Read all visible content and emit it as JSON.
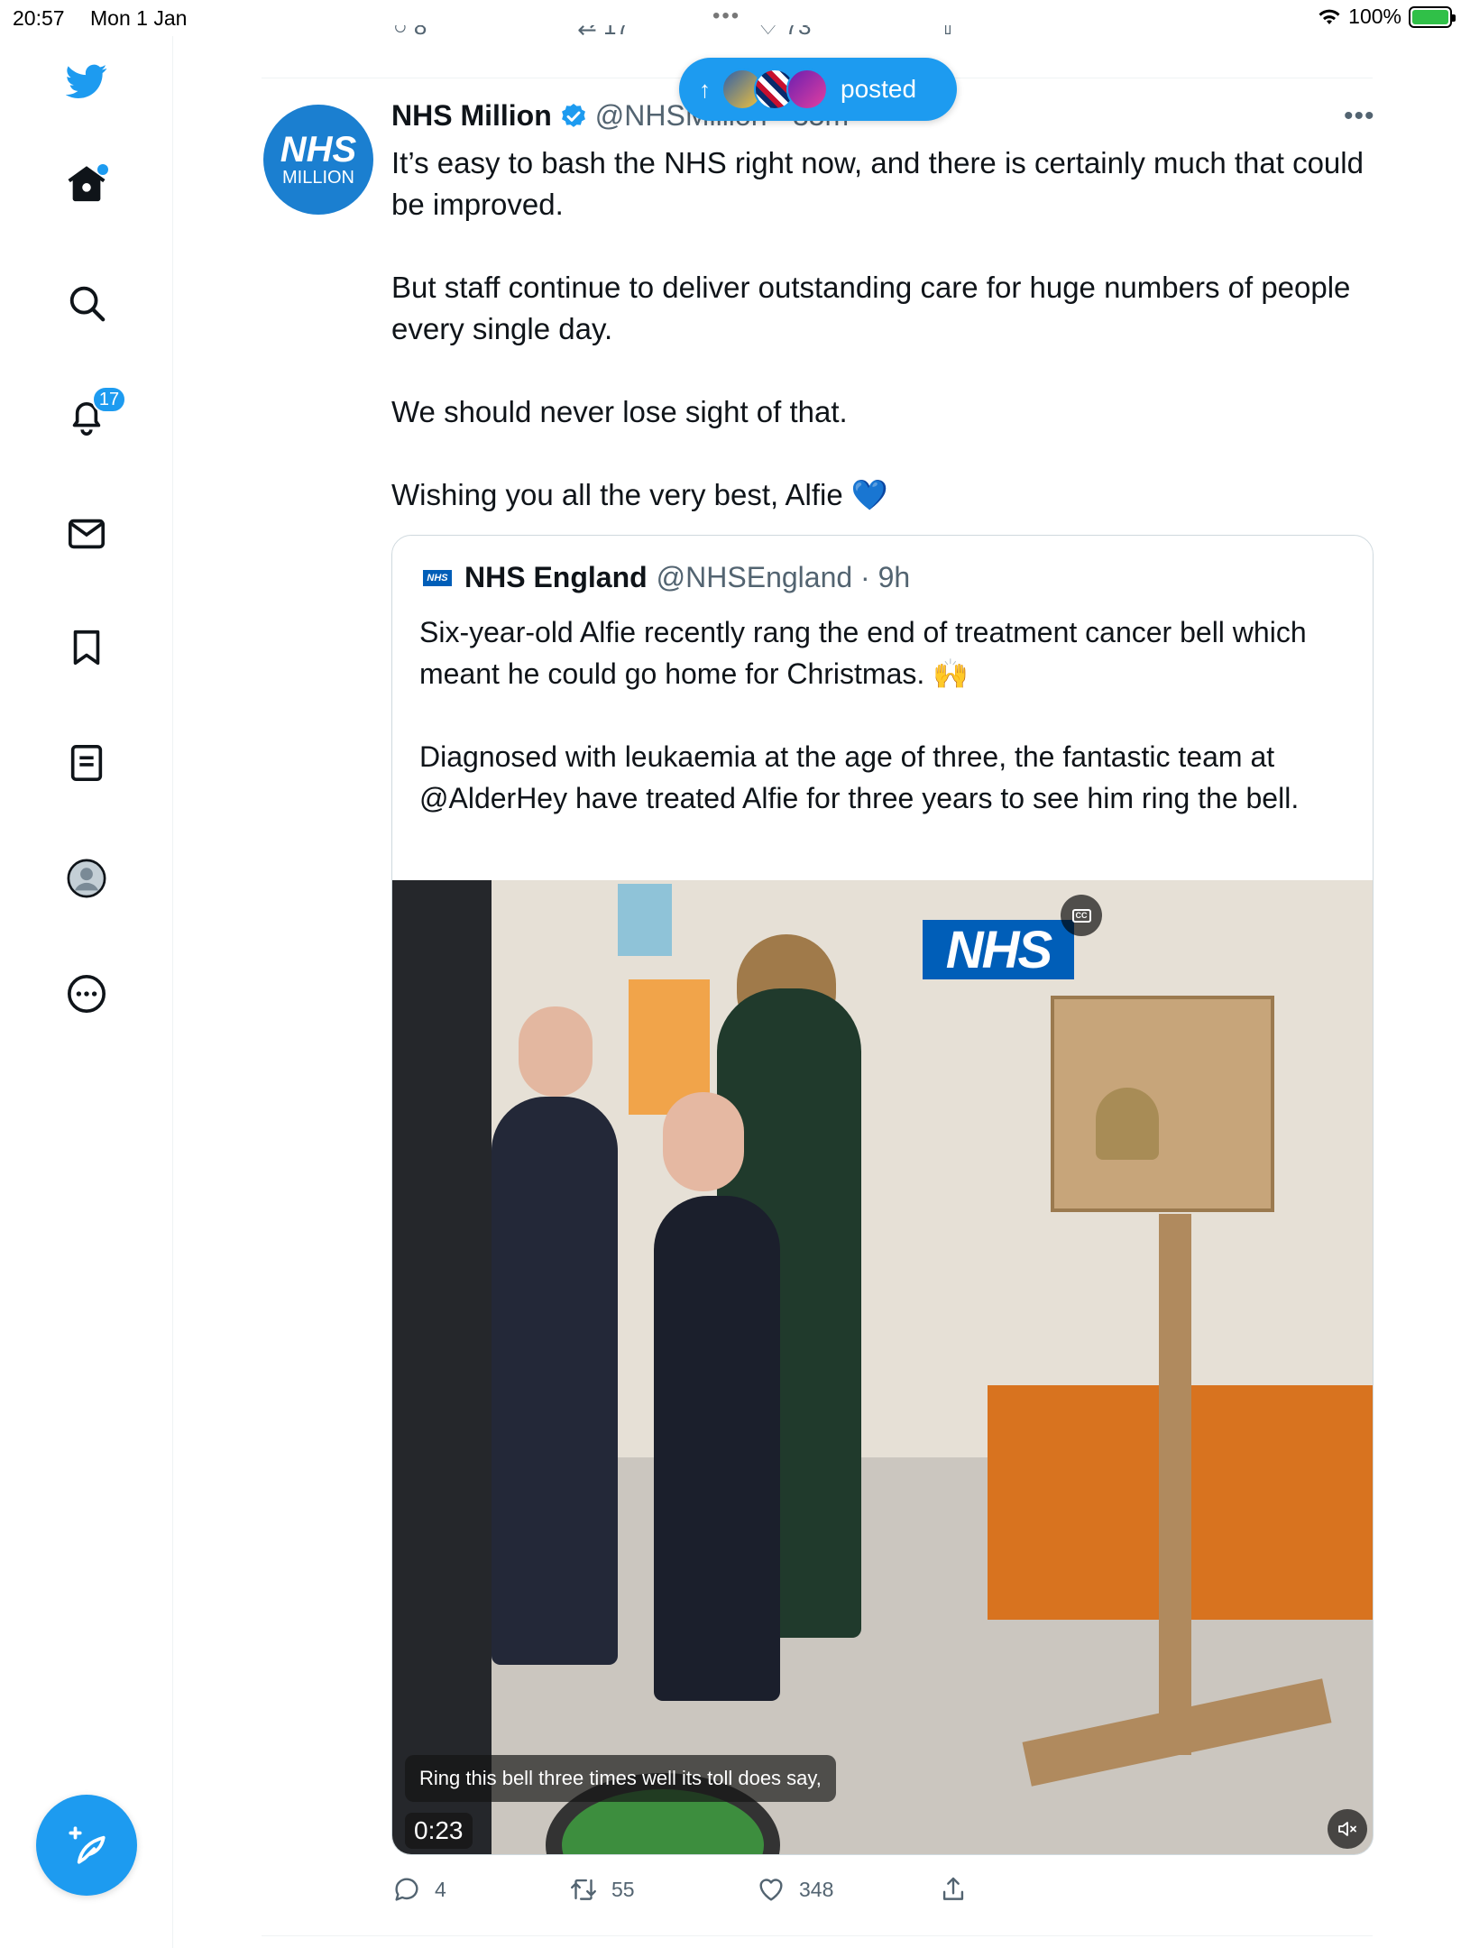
{
  "status_bar": {
    "time": "20:57",
    "date": "Mon 1 Jan",
    "battery": "100%"
  },
  "sidebar": {
    "items": [
      {
        "name": "home",
        "icon": "home-icon"
      },
      {
        "name": "explore",
        "icon": "search-icon"
      },
      {
        "name": "notifications",
        "icon": "bell-icon",
        "badge": "17"
      },
      {
        "name": "messages",
        "icon": "mail-icon"
      },
      {
        "name": "bookmarks",
        "icon": "bookmark-icon"
      },
      {
        "name": "lists",
        "icon": "list-icon"
      },
      {
        "name": "profile",
        "icon": "profile-icon"
      },
      {
        "name": "more",
        "icon": "more-icon"
      }
    ],
    "compose_icon": "compose-feather-icon"
  },
  "posted_pill": {
    "arrow": "↑",
    "label": "posted"
  },
  "tweet": {
    "avatar_top": "NHS",
    "avatar_bottom": "MILLION",
    "display_name": "NHS Million",
    "handle": "@NHSMillion · 35m",
    "more": "•••",
    "text": [
      "It’s easy to bash the NHS right now, and there is certainly much that could be improved.",
      "But staff continue to deliver outstanding care for huge numbers of people every single day.",
      "We should never lose sight of that.",
      "Wishing you all the very best, Alfie"
    ],
    "text_emoji": "💙",
    "quote": {
      "avatar_text": "NHS",
      "display_name": "NHS England",
      "handle": "@NHSEngland · 9h",
      "text": [
        "Six-year-old Alfie recently rang the end of treatment cancer bell which meant he could go home for Christmas. 🙌",
        "Diagnosed with leukaemia at the age of three, the fantastic team at @AlderHey have treated Alfie for three years to see him ring the bell."
      ],
      "video": {
        "logo": "NHS",
        "cc_label": "CC",
        "caption": "Ring this bell three times well its toll does say,",
        "duration": "0:23"
      }
    },
    "actions": {
      "replies": "4",
      "retweets": "55",
      "likes": "348"
    }
  }
}
